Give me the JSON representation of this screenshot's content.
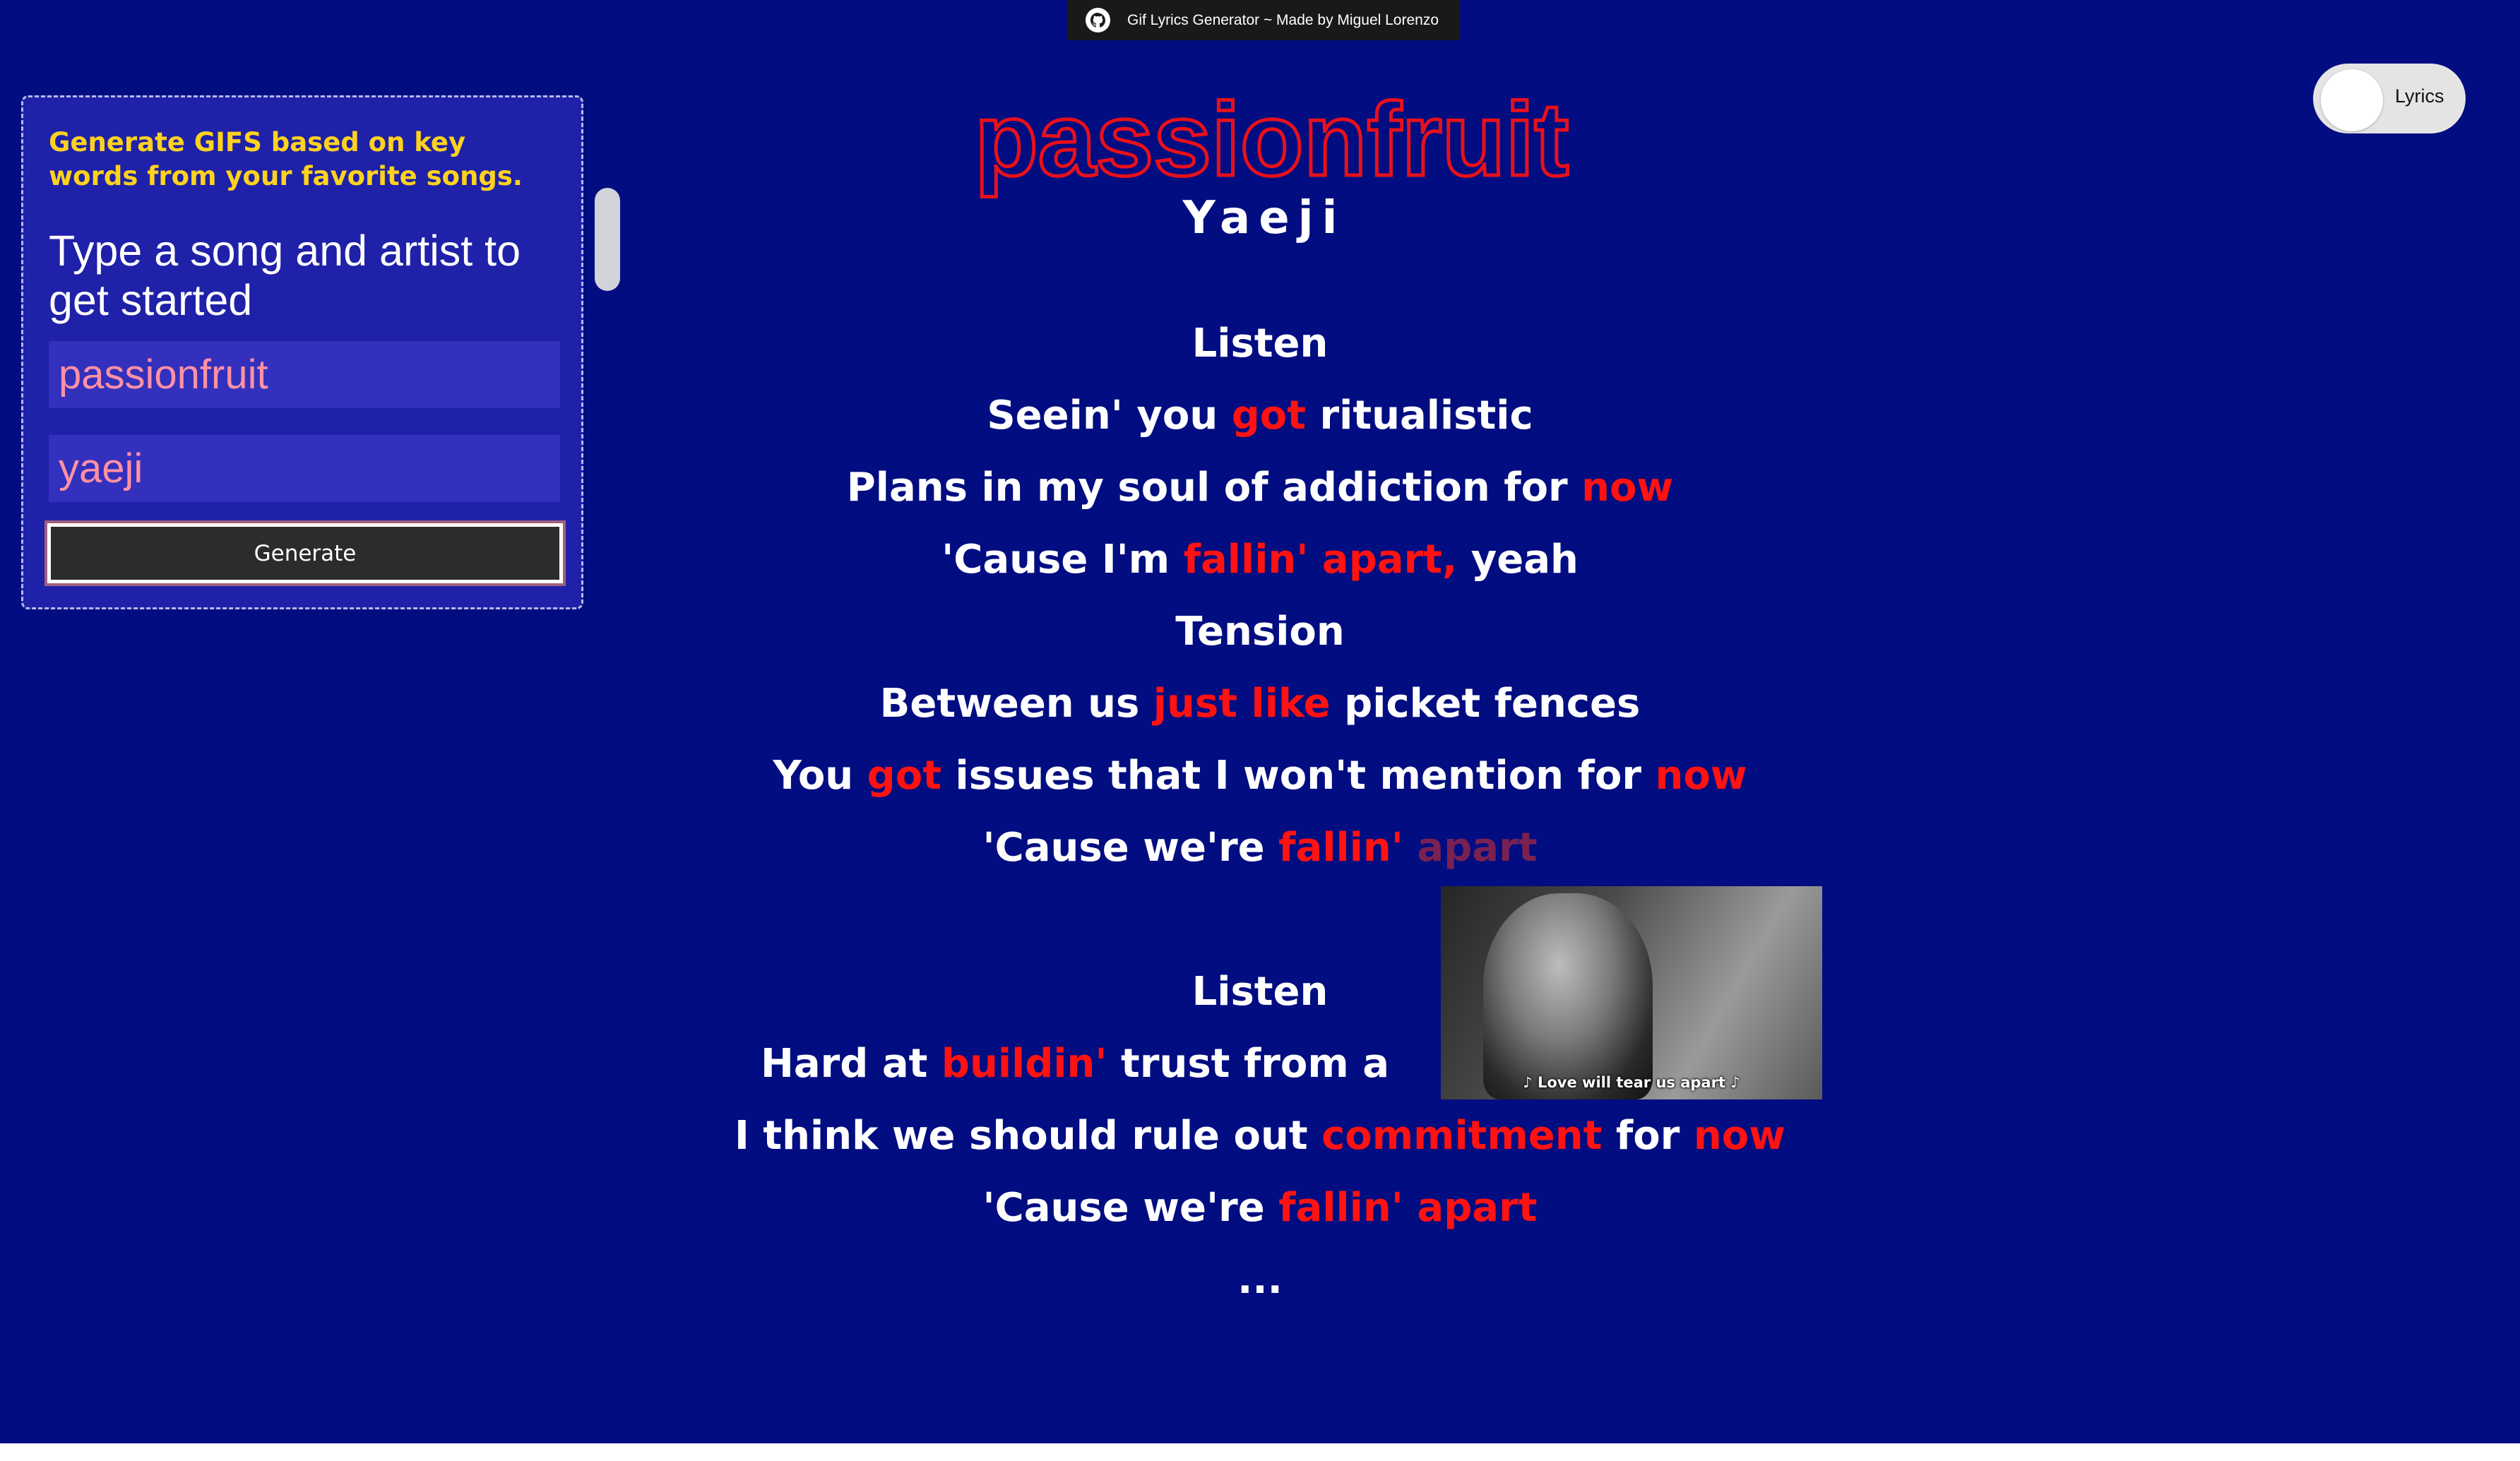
{
  "banner": {
    "icon": "github-icon",
    "text": "Gif Lyrics Generator ~ Made by Miguel Lorenzo"
  },
  "panel": {
    "tagline": "Generate GIFS based on key words from your favorite songs.",
    "prompt": "Type a song and artist to get started",
    "song_input": {
      "value": "passionfruit"
    },
    "artist_input": {
      "value": "yaeji"
    },
    "generate_label": "Generate"
  },
  "toggle": {
    "label": "Lyrics"
  },
  "song": {
    "title": "passionfruit",
    "artist": "Yaeji"
  },
  "lyrics": {
    "lines": [
      [
        {
          "t": "Listen",
          "h": 0
        }
      ],
      [
        {
          "t": "Seein' you ",
          "h": 0
        },
        {
          "t": "got",
          "h": 1
        },
        {
          "t": " ritualistic",
          "h": 0
        }
      ],
      [
        {
          "t": "Plans in my soul of addiction for ",
          "h": 0
        },
        {
          "t": "now",
          "h": 1
        }
      ],
      [
        {
          "t": "'Cause I'm ",
          "h": 0
        },
        {
          "t": "fallin' apart,",
          "h": 1
        },
        {
          "t": " yeah",
          "h": 0
        }
      ],
      [
        {
          "t": "Tension",
          "h": 0
        }
      ],
      [
        {
          "t": "Between us ",
          "h": 0
        },
        {
          "t": "just like",
          "h": 1
        },
        {
          "t": " picket fences",
          "h": 0
        }
      ],
      [
        {
          "t": "You ",
          "h": 0
        },
        {
          "t": "got",
          "h": 1
        },
        {
          "t": " issues that I won't mention for ",
          "h": 0
        },
        {
          "t": "now",
          "h": 1
        }
      ],
      [
        {
          "t": "'Cause we're ",
          "h": 0
        },
        {
          "t": "fallin'",
          "h": 1
        },
        {
          "t": " ",
          "h": 0
        },
        {
          "t": "apart",
          "h": 2
        }
      ],
      [
        {
          "t": "Listen",
          "h": 0
        }
      ],
      [
        {
          "t": "Hard at ",
          "h": 0
        },
        {
          "t": "buildin'",
          "h": 1
        },
        {
          "t": " trust from a ",
          "h": 0
        }
      ],
      [
        {
          "t": "I think we should rule out ",
          "h": 0
        },
        {
          "t": "commitment",
          "h": 1
        },
        {
          "t": " for ",
          "h": 0
        },
        {
          "t": "now",
          "h": 1
        }
      ],
      [
        {
          "t": "'Cause we're ",
          "h": 0
        },
        {
          "t": "fallin' apart",
          "h": 1
        }
      ]
    ],
    "ellipsis": "..."
  },
  "gif": {
    "caption": "♪ Love will tear us apart ♪"
  },
  "colors": {
    "background": "#010d80",
    "panel": "#1f21a8",
    "tagline": "#ffd21f",
    "highlight": "#ff1212",
    "input_text": "#ff91a4"
  }
}
